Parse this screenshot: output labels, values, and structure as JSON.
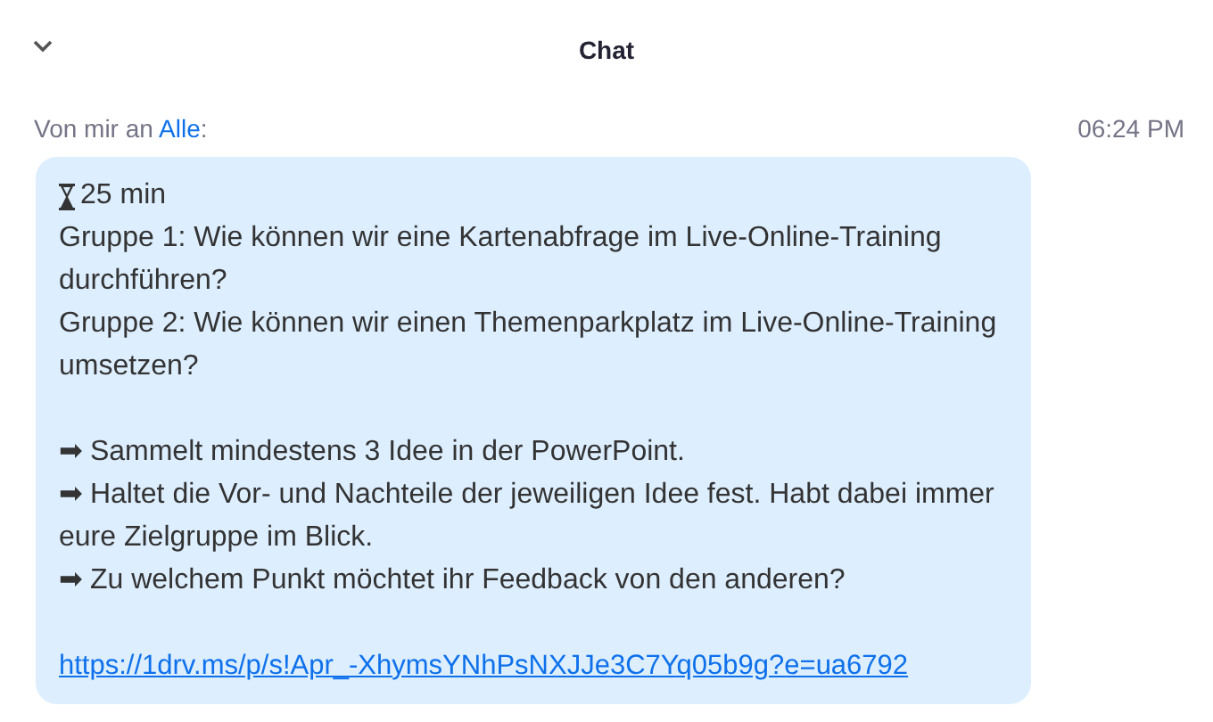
{
  "header": {
    "title": "Chat"
  },
  "message": {
    "sender": "Von mir an ",
    "recipient": "Alle",
    "colon": ":",
    "time": "06:24 PM",
    "timer": "25 min",
    "paragraphs": [
      {
        "lines": [
          "Gruppe 1: Wie können wir eine Kartenabfrage im Live-Online-Training durchführen?",
          "Gruppe 2: Wie können wir einen Themenparkplatz im Live-Online-Training umsetzen?"
        ]
      },
      {
        "lines": [
          "➡ Sammelt mindestens 3 Idee in der PowerPoint.",
          "➡ Haltet die Vor- und Nachteile der jeweiligen Idee fest. Habt dabei immer eure Zielgruppe im Blick.",
          "➡ Zu welchem Punkt möchtet ihr Feedback von den anderen?"
        ]
      }
    ],
    "link": "https://1drv.ms/p/s!Apr_-XhymsYNhPsNXJJe3C7Yq05b9g?e=ua6792"
  }
}
